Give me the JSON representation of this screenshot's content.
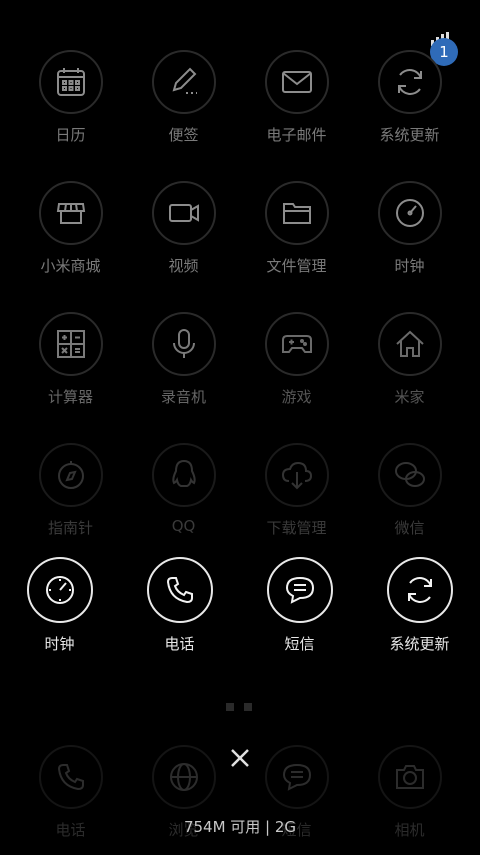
{
  "status": {
    "badge_count": "1"
  },
  "grid": [
    [
      {
        "label": "日历",
        "icon": "calendar-icon"
      },
      {
        "label": "便签",
        "icon": "notes-pencil-icon"
      },
      {
        "label": "电子邮件",
        "icon": "mail-icon"
      },
      {
        "label": "系统更新",
        "icon": "refresh-icon"
      }
    ],
    [
      {
        "label": "小米商城",
        "icon": "store-icon"
      },
      {
        "label": "视频",
        "icon": "video-camera-icon"
      },
      {
        "label": "文件管理",
        "icon": "folder-icon"
      },
      {
        "label": "时钟",
        "icon": "clock-icon"
      }
    ],
    [
      {
        "label": "计算器",
        "icon": "calculator-icon"
      },
      {
        "label": "录音机",
        "icon": "microphone-icon"
      },
      {
        "label": "游戏",
        "icon": "gamepad-icon"
      },
      {
        "label": "米家",
        "icon": "home-icon"
      }
    ],
    [
      {
        "label": "指南针",
        "icon": "compass-icon"
      },
      {
        "label": "QQ",
        "icon": "qq-penguin-icon"
      },
      {
        "label": "下载管理",
        "icon": "cloud-download-icon"
      },
      {
        "label": "微信",
        "icon": "wechat-icon"
      }
    ]
  ],
  "recents": [
    {
      "label": "时钟",
      "icon": "clock-icon"
    },
    {
      "label": "电话",
      "icon": "phone-icon"
    },
    {
      "label": "短信",
      "icon": "message-icon"
    },
    {
      "label": "系统更新",
      "icon": "refresh-icon"
    }
  ],
  "dock": [
    {
      "label": "电话",
      "icon": "phone-icon"
    },
    {
      "label": "浏览",
      "icon": "globe-icon"
    },
    {
      "label": "短信",
      "icon": "message-icon"
    },
    {
      "label": "相机",
      "icon": "camera-icon"
    }
  ],
  "footer": {
    "memory": "754M 可用 | 2G"
  }
}
